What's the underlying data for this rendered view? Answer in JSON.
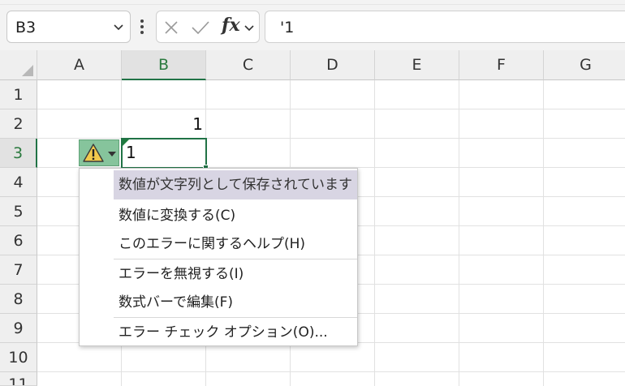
{
  "formula_bar": {
    "name_box": "B3",
    "fx": "fx",
    "formula": "'1"
  },
  "columns": [
    "A",
    "B",
    "C",
    "D",
    "E",
    "F",
    "G"
  ],
  "rows": [
    "1",
    "2",
    "3",
    "4",
    "5",
    "6",
    "7",
    "8",
    "9",
    "10",
    "11"
  ],
  "selected_cell": {
    "column": "B",
    "row": "3"
  },
  "cells": {
    "B2": "1",
    "B3": "1"
  },
  "error_menu": {
    "header": "数値が文字列として保存されています",
    "items": [
      "数値に変換する(C)",
      "このエラーに関するヘルプ(H)",
      "エラーを無視する(I)",
      "数式バーで編集(F)",
      "エラー チェック オプション(O)..."
    ]
  },
  "colors": {
    "accent": "#217346",
    "menu_header_bg": "#d8d5e3",
    "warning_button_bg": "#86c49c",
    "warning_icon": "#f2c94c"
  }
}
